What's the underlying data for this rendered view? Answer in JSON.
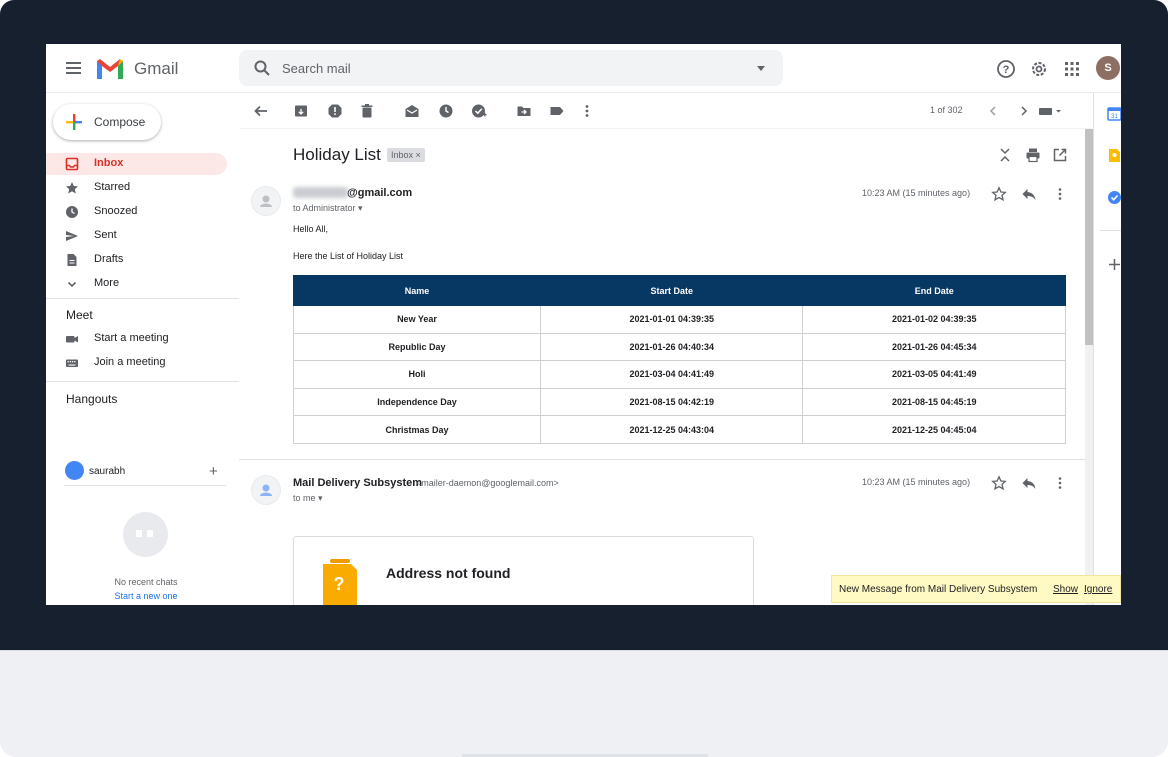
{
  "app": {
    "name": "Gmail"
  },
  "header": {
    "search_placeholder": "Search mail",
    "avatar_initial": "S"
  },
  "nav": {
    "compose_label": "Compose",
    "items": [
      {
        "label": "Inbox",
        "icon": "inbox-icon",
        "active": true
      },
      {
        "label": "Starred",
        "icon": "star-icon"
      },
      {
        "label": "Snoozed",
        "icon": "clock-icon"
      },
      {
        "label": "Sent",
        "icon": "send-icon"
      },
      {
        "label": "Drafts",
        "icon": "draft-icon"
      },
      {
        "label": "More",
        "icon": "chevron-down-icon"
      }
    ],
    "meet": {
      "title": "Meet",
      "items": [
        {
          "label": "Start a meeting",
          "icon": "video-camera-icon"
        },
        {
          "label": "Join a meeting",
          "icon": "keyboard-icon"
        }
      ]
    },
    "hangouts": {
      "title": "Hangouts",
      "user": "saurabh",
      "no_chats": "No recent chats",
      "start_new": "Start a new one"
    }
  },
  "toolbar": {
    "pager": "1 of 302"
  },
  "email": {
    "subject": "Holiday List",
    "label": "Inbox",
    "messages": [
      {
        "sender_suffix": "@gmail.com",
        "to": "to Administrator",
        "time": "10:23 AM (15 minutes ago)",
        "greeting": "Hello All,",
        "intro": "Here the List of Holiday List",
        "table": {
          "headers": [
            "Name",
            "Start Date",
            "End Date"
          ],
          "rows": [
            [
              "New Year",
              "2021-01-01 04:39:35",
              "2021-01-02 04:39:35"
            ],
            [
              "Republic Day",
              "2021-01-26 04:40:34",
              "2021-01-26 04:45:34"
            ],
            [
              "Holi",
              "2021-03-04 04:41:49",
              "2021-03-05 04:41:49"
            ],
            [
              "Independence Day",
              "2021-08-15 04:42:19",
              "2021-08-15 04:45:19"
            ],
            [
              "Christmas Day",
              "2021-12-25 04:43:04",
              "2021-12-25 04:45:04"
            ]
          ]
        }
      },
      {
        "sender": "Mail Delivery Subsystem",
        "sender_email": "<mailer-daemon@googlemail.com>",
        "to": "to me",
        "time": "10:23 AM (15 minutes ago)",
        "card_title": "Address not found"
      }
    ]
  },
  "toast": {
    "message": "New Message from Mail Delivery Subsystem",
    "show": "Show",
    "ignore": "Ignore"
  },
  "colors": {
    "accent_red": "#d93025",
    "table_header": "#073763",
    "bezel": "#16202e"
  }
}
